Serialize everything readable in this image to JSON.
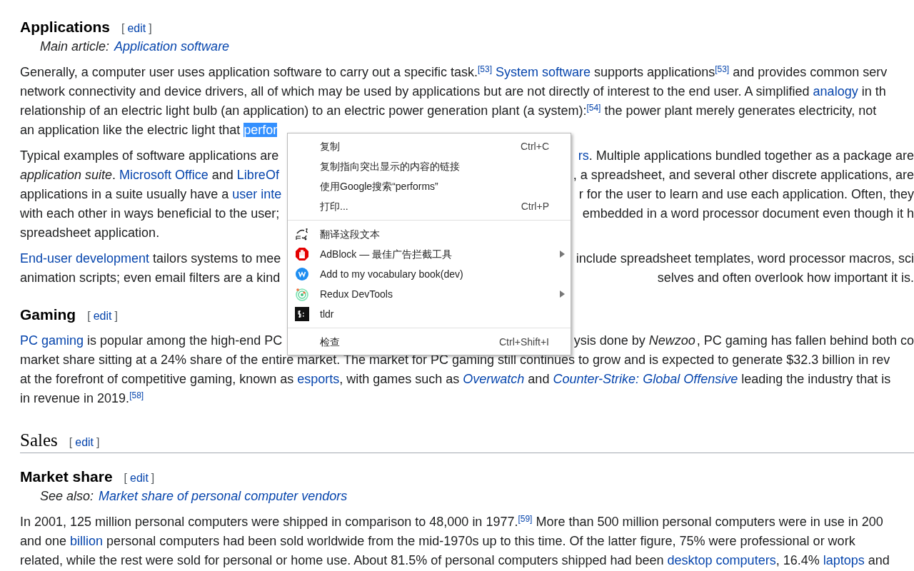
{
  "blocks": [
    {
      "kind": "h3",
      "title": "Applications",
      "edit_link": {
        "open": "[",
        "label": "edit",
        "close": "]"
      }
    },
    {
      "kind": "hatnote",
      "segments": [
        {
          "kind": "italic",
          "text": "Main article: "
        },
        {
          "kind": "italic_link",
          "text": "Application software"
        }
      ]
    },
    {
      "kind": "paragraph",
      "lines": [
        {
          "left": [
            {
              "kind": "text",
              "text": "Generally, a computer user uses application software to carry out a specific task."
            },
            {
              "kind": "sup",
              "text": "[53]"
            },
            {
              "kind": "link",
              "text": "System software"
            },
            {
              "kind": "text",
              "text": " supports applications"
            },
            {
              "kind": "sup",
              "text": "[53]"
            },
            {
              "kind": "text",
              "text": " and provides common serv"
            }
          ]
        },
        {
          "left": [
            {
              "kind": "text",
              "text": "network connectivity and device drivers, all of which may be used by applications but are not directly of interest to the end user. A simplified "
            },
            {
              "kind": "link",
              "text": "analogy"
            },
            {
              "kind": "text",
              "text": " in th"
            }
          ]
        },
        {
          "left": [
            {
              "kind": "text",
              "text": "relationship of an electric light bulb (an application) to an electric power generation plant (a system):"
            },
            {
              "kind": "sup",
              "text": "[54]"
            },
            {
              "kind": "text",
              "text": " the power plant merely generates electricity, not"
            }
          ]
        },
        {
          "left": [
            {
              "kind": "text",
              "text": "an application like the electric light that "
            },
            {
              "kind": "selected",
              "text": "perfor"
            }
          ]
        }
      ]
    },
    {
      "kind": "paragraph",
      "lines": [
        {
          "left": [
            {
              "kind": "text",
              "text": "Typical examples of software applications are"
            }
          ],
          "right": [
            {
              "kind": "link",
              "text": "rs"
            },
            {
              "kind": "text",
              "text": ". Multiple applications bundled together as a package are"
            }
          ]
        },
        {
          "left": [
            {
              "kind": "rich",
              "text": "*application suite*. "
            },
            {
              "kind": "link",
              "text": "Microsoft Office"
            },
            {
              "kind": "text",
              "text": " and "
            },
            {
              "kind": "link",
              "text": "LibreOf"
            }
          ],
          "right": [
            {
              "kind": "text",
              "text": ", a spreadsheet, and several other discrete applications, are"
            }
          ]
        },
        {
          "left": [
            {
              "kind": "text",
              "text": "applications in a suite usually have a "
            },
            {
              "kind": "link",
              "text": "user inte"
            }
          ],
          "right": [
            {
              "kind": "text",
              "text": "r for the user to learn and use each application. Often, they"
            }
          ]
        },
        {
          "left": [
            {
              "kind": "text",
              "text": "with each other in ways beneficial to the user;"
            }
          ],
          "right": [
            {
              "kind": "text",
              "text": "embedded in a word processor document even though it h"
            }
          ]
        },
        {
          "left": [
            {
              "kind": "text",
              "text": "spreadsheet application."
            }
          ]
        }
      ]
    },
    {
      "kind": "paragraph",
      "lines": [
        {
          "left": [
            {
              "kind": "link",
              "text": "End-user development"
            },
            {
              "kind": "text",
              "text": " tailors systems to mee"
            }
          ],
          "right": [
            {
              "kind": "text",
              "text": "include spreadsheet templates, word processor macros, sci"
            }
          ]
        },
        {
          "left": [
            {
              "kind": "text",
              "text": "animation scripts; even email filters are a kind"
            }
          ],
          "right": [
            {
              "kind": "text",
              "text": "selves and often overlook how important it is."
            }
          ]
        }
      ]
    },
    {
      "kind": "h3",
      "title": "Gaming",
      "edit_link": {
        "open": "[",
        "label": "edit",
        "close": "]"
      }
    },
    {
      "kind": "paragraph",
      "lines": [
        {
          "left": [
            {
              "kind": "link",
              "text": "PC gaming"
            },
            {
              "kind": "text",
              "text": " is popular among the high-end PC"
            }
          ],
          "right": [
            {
              "kind": "text",
              "text": "ysis done by "
            },
            {
              "kind": "italic",
              "text": "Newzoo"
            },
            {
              "kind": "text",
              "text": ", PC gaming has fallen behind both co"
            }
          ]
        },
        {
          "left": [
            {
              "kind": "text",
              "text": "market share sitting at a 24% share of the entire market. The market for PC gaming still continues to grow and is expected to generate $32.3 billion in rev"
            }
          ]
        },
        {
          "left": [
            {
              "kind": "text",
              "text": "at the forefront of competitive gaming, known as "
            },
            {
              "kind": "link",
              "text": "esports"
            },
            {
              "kind": "text",
              "text": ", with games such as "
            },
            {
              "kind": "italic_link",
              "text": "Overwatch"
            },
            {
              "kind": "text",
              "text": " and "
            },
            {
              "kind": "italic_link",
              "text": "Counter-Strike: Global Offensive"
            },
            {
              "kind": "text",
              "text": " leading the industry that is"
            }
          ]
        },
        {
          "left": [
            {
              "kind": "text",
              "text": "in revenue in 2019."
            },
            {
              "kind": "sup",
              "text": "[58]"
            }
          ]
        }
      ]
    },
    {
      "kind": "h2",
      "title": "Sales",
      "edit_link": {
        "open": "[",
        "label": "edit",
        "close": "]"
      }
    },
    {
      "kind": "h3",
      "title": "Market share",
      "edit_link": {
        "open": "[",
        "label": "edit",
        "close": "]"
      }
    },
    {
      "kind": "hatnote",
      "segments": [
        {
          "kind": "italic",
          "text": "See also: "
        },
        {
          "kind": "italic_link",
          "text": "Market share of personal computer vendors"
        }
      ]
    },
    {
      "kind": "paragraph",
      "lines": [
        {
          "left": [
            {
              "kind": "text",
              "text": "In 2001, 125 million personal computers were shipped in comparison to 48,000 in 1977."
            },
            {
              "kind": "sup",
              "text": "[59]"
            },
            {
              "kind": "text",
              "text": " More than 500 million personal computers were in use in 200"
            }
          ]
        },
        {
          "left": [
            {
              "kind": "text",
              "text": "and one "
            },
            {
              "kind": "link",
              "text": "billion"
            },
            {
              "kind": "text",
              "text": " personal computers had been sold worldwide from the mid-1970s up to this time. Of the latter figure, 75% were professional or work"
            }
          ]
        },
        {
          "left": [
            {
              "kind": "text",
              "text": "related, while the rest were sold for personal or home use. About 81.5% of personal computers shipped had been "
            },
            {
              "kind": "link",
              "text": "desktop computers"
            },
            {
              "kind": "text",
              "text": ", 16.4% "
            },
            {
              "kind": "link",
              "text": "laptops"
            },
            {
              "kind": "text",
              "text": " and"
            }
          ]
        }
      ]
    }
  ],
  "context_menu": {
    "groups": [
      [
        {
          "label": "复制",
          "shortcut": "Ctrl+C",
          "submenu": false
        },
        {
          "label": "复制指向突出显示的内容的链接",
          "submenu": false
        },
        {
          "label": "使用Google搜索“performs”",
          "submenu": false
        },
        {
          "label": "打印...",
          "shortcut": "Ctrl+P",
          "submenu": false
        }
      ],
      [
        {
          "label": "翻译这段文本",
          "submenu": false
        },
        {
          "label": "AdBlock — 最佳广告拦截工具",
          "submenu": true
        },
        {
          "label": "Add to my vocabulary book(dev)",
          "submenu": false
        },
        {
          "label": "Redux DevTools",
          "submenu": true
        },
        {
          "label": "tldr",
          "submenu": false
        }
      ],
      [
        {
          "label": "检查",
          "shortcut": "Ctrl+Shift+I",
          "submenu": false
        }
      ]
    ]
  }
}
